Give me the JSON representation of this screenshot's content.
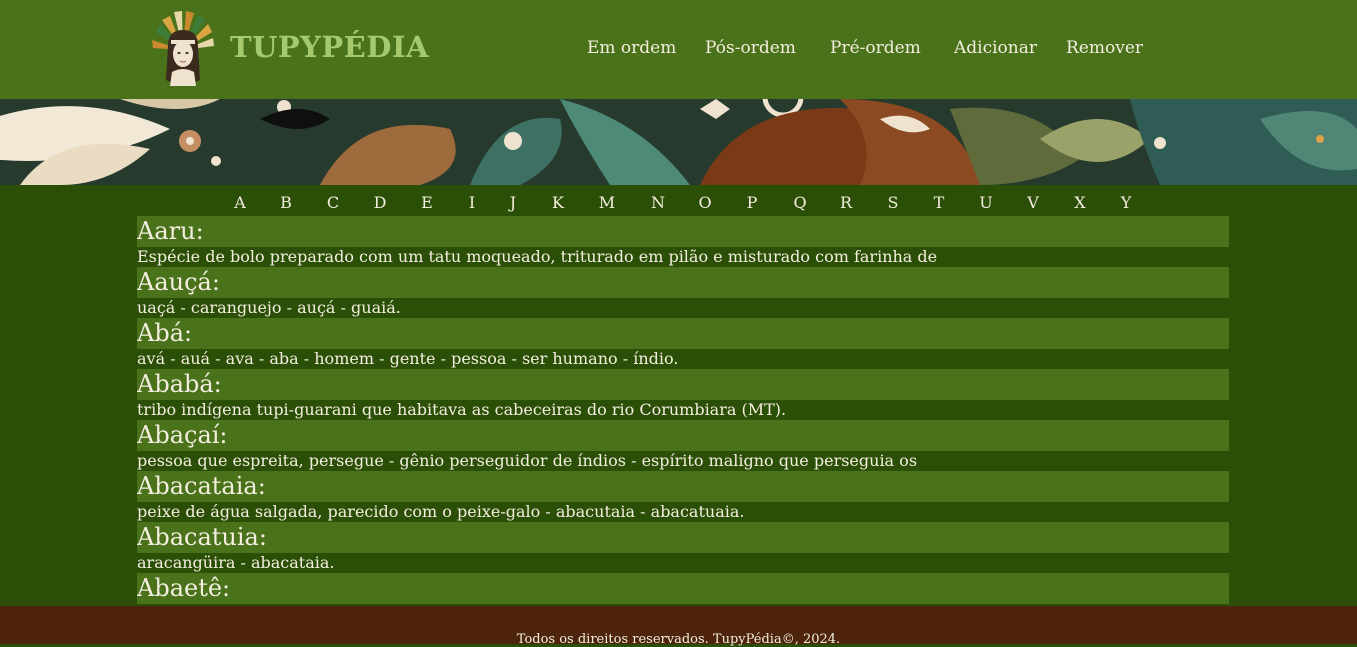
{
  "brand": {
    "name": "TUPYPÉDIA",
    "color": "#a6c96e"
  },
  "nav": [
    {
      "label": "Em ordem"
    },
    {
      "label": "Pós-ordem"
    },
    {
      "label": "Pré-ordem"
    },
    {
      "label": "Adicionar"
    },
    {
      "label": "Remover"
    }
  ],
  "alphabet": [
    "A",
    "B",
    "C",
    "D",
    "E",
    "I",
    "J",
    "K",
    "M",
    "N",
    "O",
    "P",
    "Q",
    "R",
    "S",
    "T",
    "U",
    "V",
    "X",
    "Y"
  ],
  "entries": [
    {
      "term": "Aaru:",
      "definition": "Espécie de bolo preparado com um tatu moqueado, triturado em pilão e misturado com farinha de"
    },
    {
      "term": "Aauçá:",
      "definition": "uaçá - caranguejo - auçá - guaiá."
    },
    {
      "term": "Abá:",
      "definition": "avá - auá - ava - aba - homem - gente - pessoa - ser humano - índio."
    },
    {
      "term": "Ababá:",
      "definition": "tribo indígena tupi-guarani que habitava as cabeceiras do rio Corumbiara (MT)."
    },
    {
      "term": "Abaçaí:",
      "definition": "pessoa que espreita, persegue - gênio perseguidor de índios - espírito maligno que perseguia os"
    },
    {
      "term": "Abacataia:",
      "definition": "peixe de água salgada, parecido com o peixe-galo - abacutaia - abacatuaia."
    },
    {
      "term": "Abacatuia:",
      "definition": "aracangüira - abacataia."
    },
    {
      "term": "Abaetê:",
      "definition": ""
    }
  ],
  "footer": {
    "text": "Todos os direitos reservados. TupyPédia©, 2024."
  },
  "colors": {
    "header": "#4a721b",
    "body": "#2c4f08",
    "term_bar": "#4a721b",
    "footer": "#4e240c",
    "text": "#f3eede"
  }
}
